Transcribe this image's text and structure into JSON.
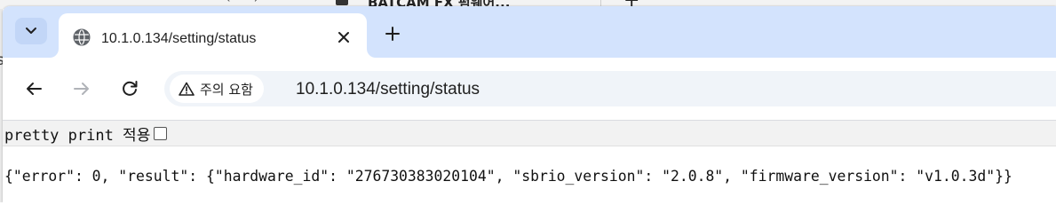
{
  "background_window": {
    "tab_title": "BATCAM FX 펌웨어..."
  },
  "tab": {
    "title": "10.1.0.134/setting/status",
    "favicon": "globe-icon"
  },
  "toolbar": {
    "security_label": "주의 요함",
    "url": "10.1.0.134/setting/status"
  },
  "page": {
    "pretty_print_label": "pretty print 적용",
    "pretty_print_checked": false,
    "json_response": "{\"error\": 0, \"result\": {\"hardware_id\": \"276730383020104\", \"sbrio_version\": \"2.0.8\", \"firmware_version\": \"v1.0.3d\"}}"
  },
  "colors": {
    "tabstrip": "#d3e3fd",
    "omnibox": "#f0f4f9",
    "pretty_bar": "#f2f2f2"
  }
}
